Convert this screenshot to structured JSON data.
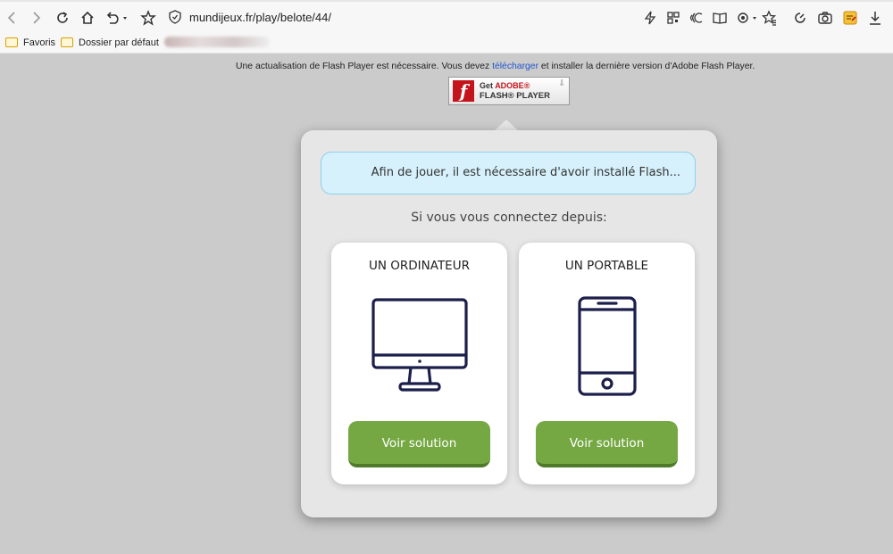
{
  "browser": {
    "url": "mundijeux.fr/play/belote/44/",
    "icons": [
      "back-icon",
      "forward-icon",
      "reload-icon",
      "home-icon",
      "undo-icon",
      "favorite-star-icon",
      "shield-icon",
      "lightning-icon",
      "qr-icon",
      "read-aloud-icon",
      "reader-icon",
      "extensions-icon",
      "favorites-icon",
      "performance-icon",
      "screenshot-icon",
      "notes-icon",
      "download-icon"
    ]
  },
  "bookmarks": {
    "items": [
      {
        "label": "Favoris"
      },
      {
        "label": "Dossier par défaut"
      }
    ]
  },
  "flash": {
    "message_before": "Une actualisation de Flash Player est nécessaire. Vous devez ",
    "link": "télécharger",
    "message_after": " et installer la dernière version d'Adobe Flash Player.",
    "badge_get": "Get",
    "badge_adobe": "ADOBE®",
    "badge_product": "FLASH® PLAYER",
    "badge_logo": "f"
  },
  "modal": {
    "info": "Afin de jouer, il est nécessaire d'avoir installé Flash...",
    "subtitle": "Si vous vous connectez depuis:",
    "cards": [
      {
        "title": "UN ORDINATEUR",
        "icon": "desktop-computer-icon",
        "button": "Voir solution"
      },
      {
        "title": "UN PORTABLE",
        "icon": "smartphone-icon",
        "button": "Voir solution"
      }
    ]
  },
  "colors": {
    "page_bg": "#cbcbcb",
    "modal_bg": "#e6e6e6",
    "info_bg": "#d6f1fb",
    "button_green": "#75a843",
    "icon_navy": "#1c1f4a",
    "flash_red": "#c4141b"
  }
}
